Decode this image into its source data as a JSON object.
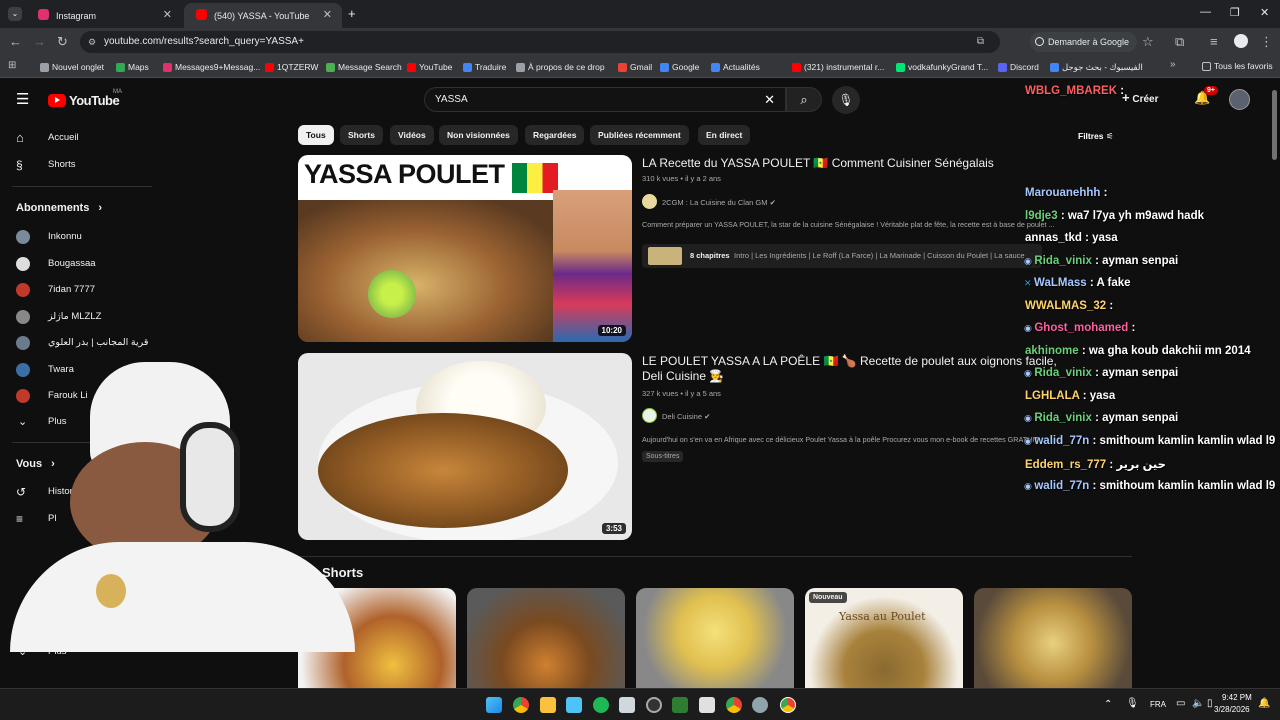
{
  "browser": {
    "tabs": [
      {
        "title": "Instagram",
        "active": false,
        "color": "#e1306c"
      },
      {
        "title": "(540) YASSA - YouTube",
        "active": true,
        "color": "#ff0000"
      }
    ],
    "new_tab": "+",
    "url": "youtube.com/results?search_query=YASSA+",
    "google_btn": "Demander à Google",
    "bookmarks": [
      {
        "label": "Nouvel onglet",
        "color": "#9aa0a6"
      },
      {
        "label": "Maps",
        "color": "#34a853"
      },
      {
        "label": "Messages9+Messag...",
        "color": "#e1306c"
      },
      {
        "label": "1QTZERW",
        "color": "#ff0000"
      },
      {
        "label": "Message Search",
        "color": "#4caf50"
      },
      {
        "label": "YouTube",
        "color": "#ff0000"
      },
      {
        "label": "Traduire",
        "color": "#4285f4"
      },
      {
        "label": "À propos de ce drop",
        "color": "#9aa0a6"
      },
      {
        "label": "Gmail",
        "color": "#ea4335"
      },
      {
        "label": "Google",
        "color": "#4285f4"
      },
      {
        "label": "Actualités",
        "color": "#4285f4"
      },
      {
        "label": "(321) instrumental r...",
        "color": "#ff0000"
      },
      {
        "label": "vodkafunkyGrand T...",
        "color": "#00e676"
      },
      {
        "label": "Discord",
        "color": "#5865f2"
      },
      {
        "label": "الفيسبوك - بحث جوجل",
        "color": "#4285f4"
      }
    ],
    "all_bookmarks": "Tous les favoris"
  },
  "youtube": {
    "logo": "YouTube",
    "logo_region": "MA",
    "search_value": "YASSA",
    "notifications": "9+",
    "create_label": "Créer",
    "sidebar": {
      "main": [
        {
          "label": "Accueil",
          "icon": "home-icon"
        },
        {
          "label": "Shorts",
          "icon": "shorts-icon"
        }
      ],
      "subs_heading": "Abonnements",
      "subs": [
        {
          "label": "Inkonnu",
          "color": "#7a8a9a"
        },
        {
          "label": "Bougassaa",
          "color": "#dddddd"
        },
        {
          "label": "7idan 7777",
          "color": "#c0392b"
        },
        {
          "label": "ماژلز MLZLZ",
          "color": "#888888"
        },
        {
          "label": "قرية المجانب | بدر العلوي",
          "color": "#6b7b8b"
        },
        {
          "label": "Twara",
          "color": "#3a6ea5"
        },
        {
          "label": "Farouk Li",
          "color": "#c0392b"
        }
      ],
      "more_label": "Plus",
      "you_heading": "Vous",
      "you_items": [
        {
          "label": "Historique"
        },
        {
          "label": "Pl"
        }
      ],
      "more2_label": "Plus"
    },
    "chips": [
      "Tous",
      "Shorts",
      "Vidéos",
      "Non visionnées",
      "Regardées",
      "Publiées récemment",
      "En direct"
    ],
    "videos": [
      {
        "thumb_text": "YASSA POULET",
        "duration": "10:20",
        "title": "LA Recette du YASSA POULET 🇸🇳 Comment Cuisiner Sénégalais",
        "views": "310 k vues",
        "age": "il y a 2 ans",
        "channel": "2CGM : La Cuisine du Clan GM",
        "description": "Comment préparer un YASSA POULET, la star de la cuisine Sénégalaise ! Véritable plat de fête, la recette est à base de poulet ...",
        "chapters_label": "8 chapitres",
        "chapters": "Intro | Les Ingrédients | Le Roff (La Farce) | La Marinade | Cuisson du Poulet | La sauce"
      },
      {
        "duration": "3:53",
        "title": "LE POULET YASSA A LA POÊLE 🇸🇳 🍗 Recette de poulet aux oignons facile, Deli Cuisine 🧑‍🍳",
        "views": "327 k vues",
        "age": "il y a 5 ans",
        "channel": "Deli Cuisine",
        "description": "Aujourd'hui on s'en va en Afrique avec ce délicieux Poulet Yassa à la poêle Procurez vous mon e-book de recettes GRATUIT ...",
        "badge": "Sous-titres"
      }
    ],
    "shorts_heading": "Shorts",
    "shorts": [
      {
        "label": ""
      },
      {
        "label": ""
      },
      {
        "label": ""
      },
      {
        "label": "Nouveau",
        "overlay": "Yassa au Poulet"
      },
      {
        "label": ""
      }
    ],
    "filter_label": "Filtres"
  },
  "chat": [
    {
      "name": "WBLG_MBAREK",
      "msg": ":",
      "color": "#ff5f5f"
    },
    {
      "name": "Marouanehhh",
      "msg": ":",
      "color": "#a6c8ff"
    },
    {
      "name": "l9dje3",
      "msg": ": wa7 l7ya yh m9awd hadk",
      "color": "#6ad17a"
    },
    {
      "name": "annas_tkd",
      "msg": ": yasa",
      "color": "#ffffff"
    },
    {
      "name": "Rida_vinix",
      "msg": ": ayman senpai",
      "color": "#6ad17a"
    },
    {
      "name": "WaLMass",
      "msg": ": A fake",
      "color": "#a6c8ff"
    },
    {
      "name": "WWALMAS_32",
      "msg": ":",
      "color": "#ffd36a"
    },
    {
      "name": "Ghost_mohamed",
      "msg": ":",
      "color": "#ff5fa0"
    },
    {
      "name": "akhinome",
      "msg": ": wa gha koub dakchii mn 2014",
      "color": "#6ad17a"
    },
    {
      "name": "Rida_vinix",
      "msg": ": ayman senpai",
      "color": "#6ad17a"
    },
    {
      "name": "LGHLALA",
      "msg": ": yasa",
      "color": "#ffd36a"
    },
    {
      "name": "Rida_vinix",
      "msg": ": ayman senpai",
      "color": "#6ad17a"
    },
    {
      "name": "walid_77n",
      "msg": ": smithoum kamlin kamlin wlad l9",
      "color": "#a6c8ff"
    },
    {
      "name": "Eddem_rs_777",
      "msg": ": حين برير",
      "color": "#ffd36a"
    },
    {
      "name": "walid_77n",
      "msg": ": smithoum kamlin kamlin wlad l9",
      "color": "#a6c8ff"
    }
  ],
  "taskbar": {
    "lang": "FRA",
    "time": "9:42 PM",
    "date": "3/28/2026"
  }
}
